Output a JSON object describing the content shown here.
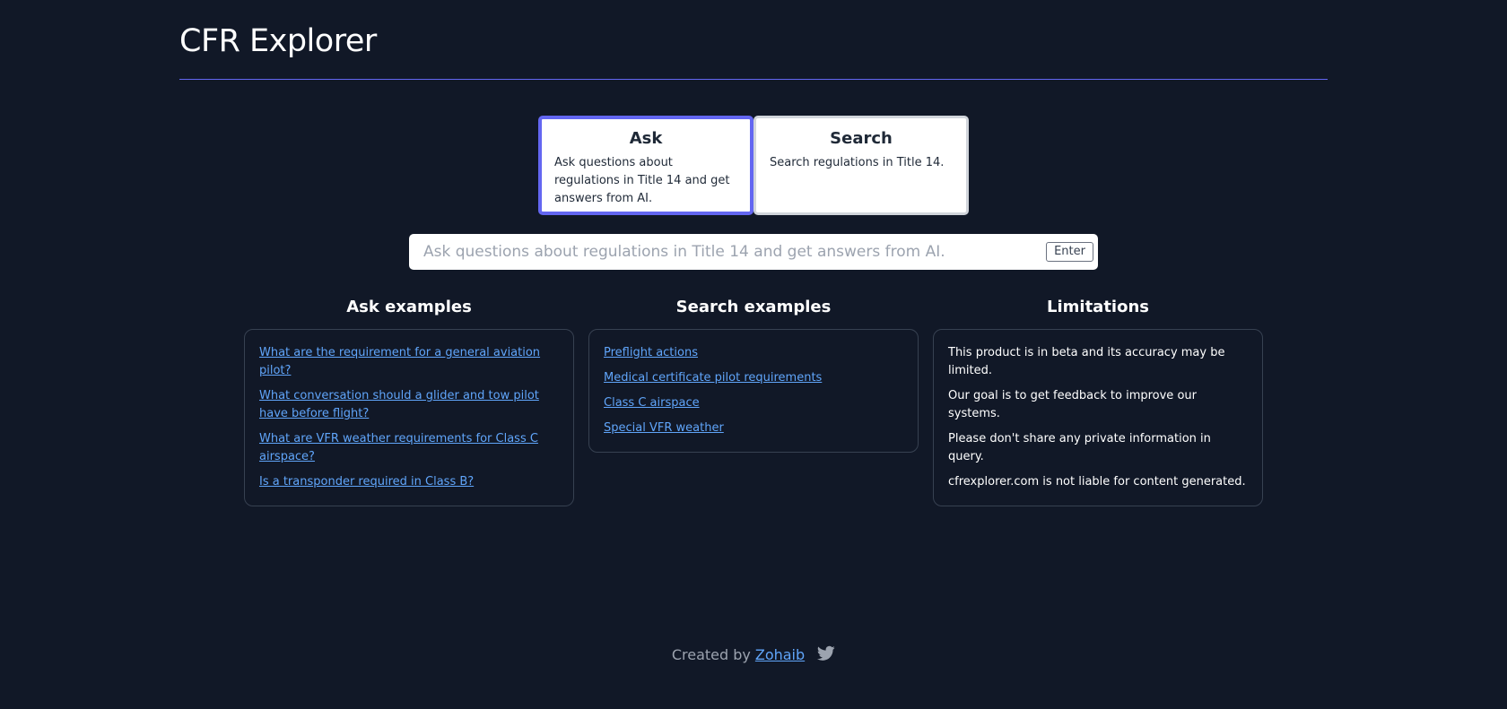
{
  "header": {
    "title": "CFR Explorer"
  },
  "modes": [
    {
      "title": "Ask",
      "description": "Ask questions about regulations in Title 14 and get answers from AI."
    },
    {
      "title": "Search",
      "description": "Search regulations in Title 14."
    }
  ],
  "search": {
    "placeholder": "Ask questions about regulations in Title 14 and get answers from AI.",
    "enter_label": "Enter"
  },
  "ask_examples": {
    "heading": "Ask examples",
    "items": [
      "What are the requirement for a general aviation pilot?",
      "What conversation should a glider and tow pilot have before flight?",
      "What are VFR weather requirements for Class C airspace?",
      "Is a transponder required in Class B?"
    ]
  },
  "search_examples": {
    "heading": "Search examples",
    "items": [
      "Preflight actions",
      "Medical certificate pilot requirements",
      "Class C airspace",
      "Special VFR weather"
    ]
  },
  "limitations": {
    "heading": "Limitations",
    "items": [
      "This product is in beta and its accuracy may be limited.",
      "Our goal is to get feedback to improve our systems.",
      "Please don't share any private information in query.",
      "cfrexplorer.com is not liable for content generated."
    ]
  },
  "footer": {
    "created_by": "Created by",
    "author": "Zohaib"
  },
  "colors": {
    "background": "#111827",
    "accent": "#6366f1",
    "link": "#60a5fa"
  },
  "icons": {
    "social": "twitter-icon"
  }
}
